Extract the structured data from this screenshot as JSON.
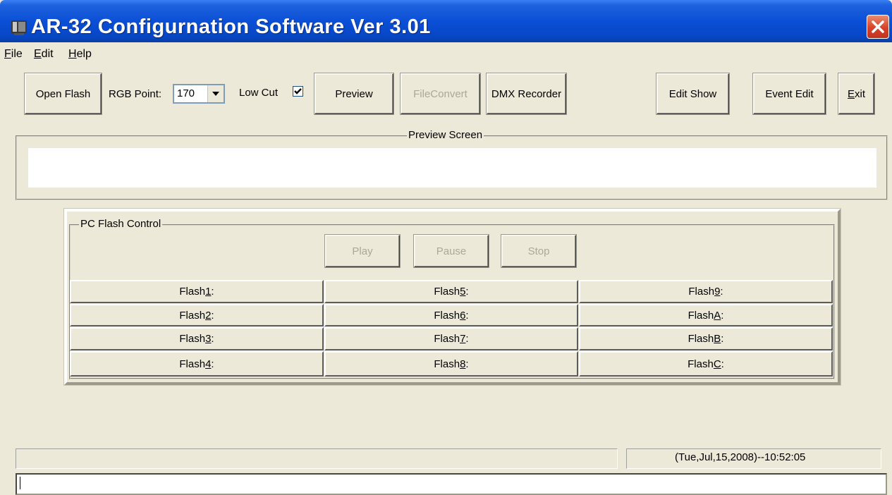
{
  "window": {
    "title": "AR-32 Configurnation Software Ver 3.01",
    "close_icon": "close-icon",
    "app_icon": "application-icon"
  },
  "menu": {
    "file": {
      "mnemonic": "F",
      "rest": "ile"
    },
    "edit": {
      "mnemonic": "E",
      "rest": "dit"
    },
    "help": {
      "mnemonic": "H",
      "rest": "elp"
    }
  },
  "toolbar": {
    "open_flash": "Open Flash",
    "rgb_label": "RGB Point:",
    "rgb_value": "170",
    "low_cut_label": "Low Cut",
    "low_cut_checked": true,
    "preview": "Preview",
    "file_convert": "FileConvert",
    "dmx_recorder": "DMX Recorder",
    "edit_show": "Edit Show",
    "event_edit": "Event Edit",
    "exit": {
      "mnemonic": "E",
      "rest": "xit"
    }
  },
  "preview_screen": {
    "legend": "Preview Screen"
  },
  "pc_flash_control": {
    "legend": "PC Flash Control",
    "play": "Play",
    "pause": "Pause",
    "stop": "Stop",
    "rows": [
      [
        {
          "pre": "Flash",
          "key": "1",
          "post": ":"
        },
        {
          "pre": "Flash",
          "key": "5",
          "post": ":"
        },
        {
          "pre": "Flash",
          "key": "9",
          "post": ":"
        }
      ],
      [
        {
          "pre": "Flash",
          "key": "2",
          "post": ":"
        },
        {
          "pre": "Flash",
          "key": "6",
          "post": ":"
        },
        {
          "pre": "Flash",
          "key": "A",
          "post": ":"
        }
      ],
      [
        {
          "pre": "Flash",
          "key": "3",
          "post": ":"
        },
        {
          "pre": "Flash",
          "key": "7",
          "post": ":"
        },
        {
          "pre": "Flash",
          "key": "B",
          "post": ":"
        }
      ],
      [
        {
          "pre": "Flash",
          "key": "4",
          "post": ":"
        },
        {
          "pre": "Flash",
          "key": "8",
          "post": ":"
        },
        {
          "pre": "Flash",
          "key": "C",
          "post": ":"
        }
      ]
    ]
  },
  "status": {
    "left_text": "",
    "datetime": "(Tue,Jul,15,2008)--10:52:05",
    "input_value": ""
  },
  "colors": {
    "titlebar": "#0a4fd6",
    "face": "#ece9d8",
    "close": "#d7412b"
  }
}
